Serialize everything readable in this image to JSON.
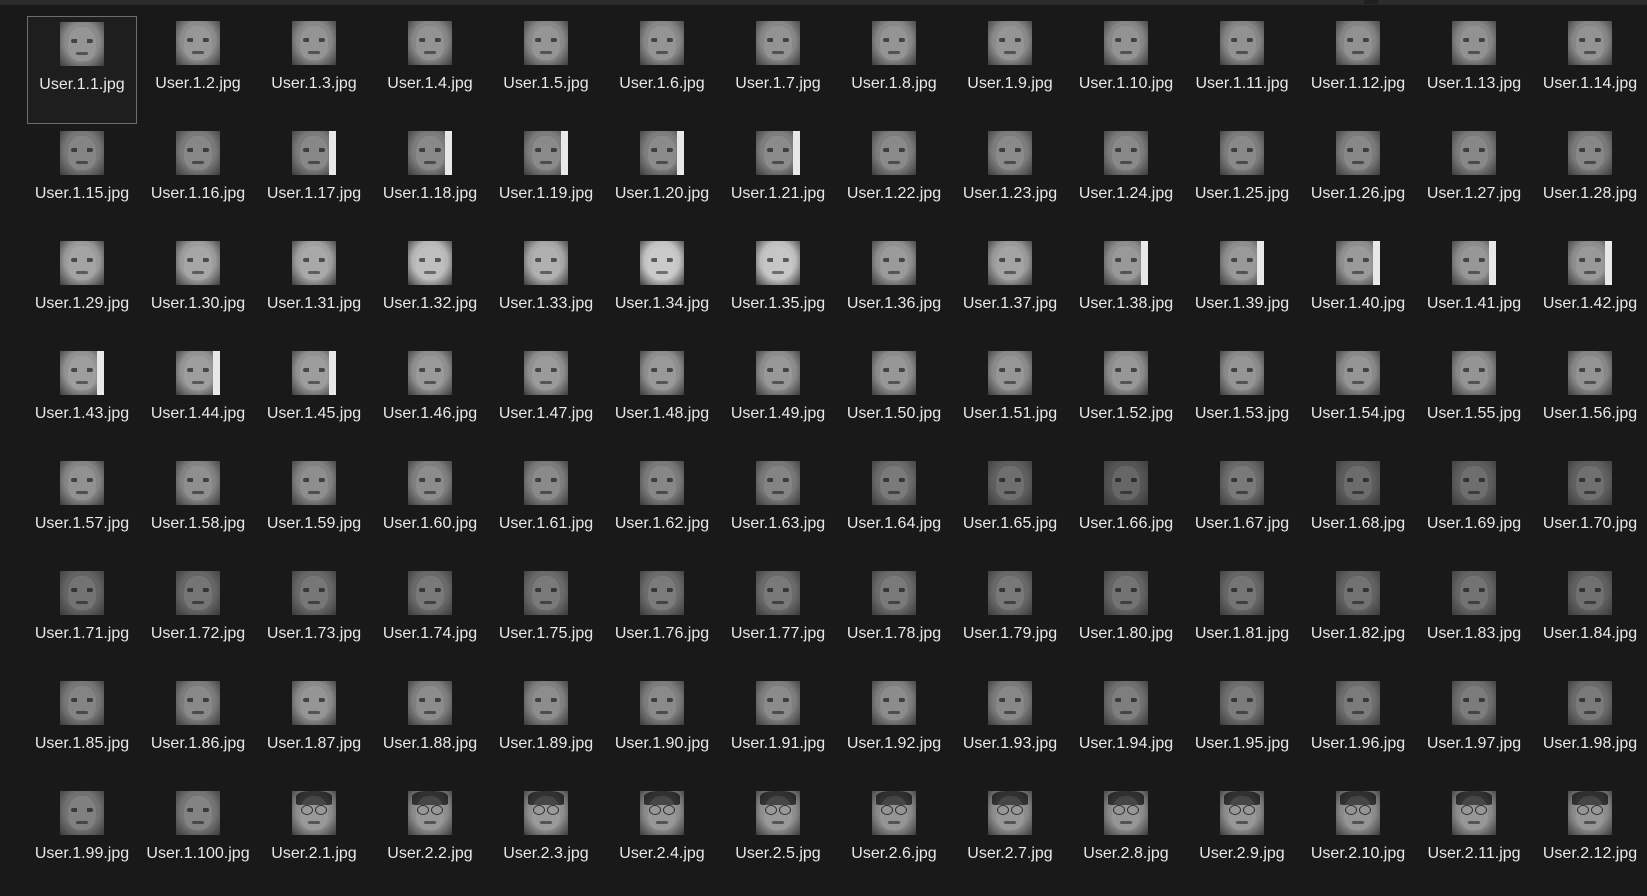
{
  "explorer": {
    "selected_index": 0,
    "files": [
      {
        "name": "User.1.1.jpg",
        "tone": "#8a8a8a"
      },
      {
        "name": "User.1.2.jpg",
        "tone": "#8c8c8c"
      },
      {
        "name": "User.1.3.jpg",
        "tone": "#888888"
      },
      {
        "name": "User.1.4.jpg",
        "tone": "#878787"
      },
      {
        "name": "User.1.5.jpg",
        "tone": "#898989"
      },
      {
        "name": "User.1.6.jpg",
        "tone": "#888888"
      },
      {
        "name": "User.1.7.jpg",
        "tone": "#878787"
      },
      {
        "name": "User.1.8.jpg",
        "tone": "#888888"
      },
      {
        "name": "User.1.9.jpg",
        "tone": "#8a8a8a"
      },
      {
        "name": "User.1.10.jpg",
        "tone": "#878787"
      },
      {
        "name": "User.1.11.jpg",
        "tone": "#868686"
      },
      {
        "name": "User.1.12.jpg",
        "tone": "#858585"
      },
      {
        "name": "User.1.13.jpg",
        "tone": "#868686"
      },
      {
        "name": "User.1.14.jpg",
        "tone": "#878787"
      },
      {
        "name": "User.1.15.jpg",
        "tone": "#787878"
      },
      {
        "name": "User.1.16.jpg",
        "tone": "#7a7a7a"
      },
      {
        "name": "User.1.17.jpg",
        "tone": "#7b7b7b",
        "stripe": true
      },
      {
        "name": "User.1.18.jpg",
        "tone": "#7c7c7c",
        "stripe": true
      },
      {
        "name": "User.1.19.jpg",
        "tone": "#7d7d7d",
        "stripe": true
      },
      {
        "name": "User.1.20.jpg",
        "tone": "#7e7e7e",
        "stripe": true
      },
      {
        "name": "User.1.21.jpg",
        "tone": "#7e7e7e",
        "stripe": true
      },
      {
        "name": "User.1.22.jpg",
        "tone": "#7d7d7d"
      },
      {
        "name": "User.1.23.jpg",
        "tone": "#7d7d7d"
      },
      {
        "name": "User.1.24.jpg",
        "tone": "#7c7c7c"
      },
      {
        "name": "User.1.25.jpg",
        "tone": "#7c7c7c"
      },
      {
        "name": "User.1.26.jpg",
        "tone": "#7b7b7b"
      },
      {
        "name": "User.1.27.jpg",
        "tone": "#7b7b7b"
      },
      {
        "name": "User.1.28.jpg",
        "tone": "#7a7a7a"
      },
      {
        "name": "User.1.29.jpg",
        "tone": "#9a9a9a"
      },
      {
        "name": "User.1.30.jpg",
        "tone": "#9c9c9c"
      },
      {
        "name": "User.1.31.jpg",
        "tone": "#a0a0a0"
      },
      {
        "name": "User.1.32.jpg",
        "tone": "#b8b8b8"
      },
      {
        "name": "User.1.33.jpg",
        "tone": "#a8a8a8"
      },
      {
        "name": "User.1.34.jpg",
        "tone": "#c4c4c4"
      },
      {
        "name": "User.1.35.jpg",
        "tone": "#c0c0c0"
      },
      {
        "name": "User.1.36.jpg",
        "tone": "#909090"
      },
      {
        "name": "User.1.37.jpg",
        "tone": "#9a9a9a"
      },
      {
        "name": "User.1.38.jpg",
        "tone": "#8e8e8e",
        "stripe": true
      },
      {
        "name": "User.1.39.jpg",
        "tone": "#8e8e8e",
        "stripe": true
      },
      {
        "name": "User.1.40.jpg",
        "tone": "#8f8f8f",
        "stripe": true
      },
      {
        "name": "User.1.41.jpg",
        "tone": "#8c8c8c",
        "stripe": true
      },
      {
        "name": "User.1.42.jpg",
        "tone": "#8e8e8e",
        "stripe": true
      },
      {
        "name": "User.1.43.jpg",
        "tone": "#939393",
        "stripe": true
      },
      {
        "name": "User.1.44.jpg",
        "tone": "#949494",
        "stripe": true
      },
      {
        "name": "User.1.45.jpg",
        "tone": "#929292",
        "stripe": true
      },
      {
        "name": "User.1.46.jpg",
        "tone": "#8f8f8f"
      },
      {
        "name": "User.1.47.jpg",
        "tone": "#909090"
      },
      {
        "name": "User.1.48.jpg",
        "tone": "#8e8e8e"
      },
      {
        "name": "User.1.49.jpg",
        "tone": "#8d8d8d"
      },
      {
        "name": "User.1.50.jpg",
        "tone": "#8c8c8c"
      },
      {
        "name": "User.1.51.jpg",
        "tone": "#8b8b8b"
      },
      {
        "name": "User.1.52.jpg",
        "tone": "#8c8c8c"
      },
      {
        "name": "User.1.53.jpg",
        "tone": "#8a8a8a"
      },
      {
        "name": "User.1.54.jpg",
        "tone": "#898989"
      },
      {
        "name": "User.1.55.jpg",
        "tone": "#888888"
      },
      {
        "name": "User.1.56.jpg",
        "tone": "#878787"
      },
      {
        "name": "User.1.57.jpg",
        "tone": "#858585"
      },
      {
        "name": "User.1.58.jpg",
        "tone": "#838383"
      },
      {
        "name": "User.1.59.jpg",
        "tone": "#828282"
      },
      {
        "name": "User.1.60.jpg",
        "tone": "#7f7f7f"
      },
      {
        "name": "User.1.61.jpg",
        "tone": "#7d7d7d"
      },
      {
        "name": "User.1.62.jpg",
        "tone": "#7a7a7a"
      },
      {
        "name": "User.1.63.jpg",
        "tone": "#777777"
      },
      {
        "name": "User.1.64.jpg",
        "tone": "#6b6b6b"
      },
      {
        "name": "User.1.65.jpg",
        "tone": "#5f5f5f"
      },
      {
        "name": "User.1.66.jpg",
        "tone": "#555555"
      },
      {
        "name": "User.1.67.jpg",
        "tone": "#6a6a6a"
      },
      {
        "name": "User.1.68.jpg",
        "tone": "#5c5c5c"
      },
      {
        "name": "User.1.69.jpg",
        "tone": "#5e5e5e"
      },
      {
        "name": "User.1.70.jpg",
        "tone": "#606060"
      },
      {
        "name": "User.1.71.jpg",
        "tone": "#646464"
      },
      {
        "name": "User.1.72.jpg",
        "tone": "#666666"
      },
      {
        "name": "User.1.73.jpg",
        "tone": "#686868"
      },
      {
        "name": "User.1.74.jpg",
        "tone": "#6a6a6a"
      },
      {
        "name": "User.1.75.jpg",
        "tone": "#6b6b6b"
      },
      {
        "name": "User.1.76.jpg",
        "tone": "#6c6c6c"
      },
      {
        "name": "User.1.77.jpg",
        "tone": "#6a6a6a"
      },
      {
        "name": "User.1.78.jpg",
        "tone": "#6b6b6b"
      },
      {
        "name": "User.1.79.jpg",
        "tone": "#696969"
      },
      {
        "name": "User.1.80.jpg",
        "tone": "#646464"
      },
      {
        "name": "User.1.81.jpg",
        "tone": "#666666"
      },
      {
        "name": "User.1.82.jpg",
        "tone": "#626262"
      },
      {
        "name": "User.1.83.jpg",
        "tone": "#646464"
      },
      {
        "name": "User.1.84.jpg",
        "tone": "#606060"
      },
      {
        "name": "User.1.85.jpg",
        "tone": "#777777"
      },
      {
        "name": "User.1.86.jpg",
        "tone": "#7c7c7c"
      },
      {
        "name": "User.1.87.jpg",
        "tone": "#8a8a8a"
      },
      {
        "name": "User.1.88.jpg",
        "tone": "#7f7f7f"
      },
      {
        "name": "User.1.89.jpg",
        "tone": "#818181"
      },
      {
        "name": "User.1.90.jpg",
        "tone": "#7d7d7d"
      },
      {
        "name": "User.1.91.jpg",
        "tone": "#7e7e7e"
      },
      {
        "name": "User.1.92.jpg",
        "tone": "#7f7f7f"
      },
      {
        "name": "User.1.93.jpg",
        "tone": "#7b7b7b"
      },
      {
        "name": "User.1.94.jpg",
        "tone": "#707070"
      },
      {
        "name": "User.1.95.jpg",
        "tone": "#6e6e6e"
      },
      {
        "name": "User.1.96.jpg",
        "tone": "#6d6d6d"
      },
      {
        "name": "User.1.97.jpg",
        "tone": "#6e6e6e"
      },
      {
        "name": "User.1.98.jpg",
        "tone": "#6b6b6b"
      },
      {
        "name": "User.1.99.jpg",
        "tone": "#727272"
      },
      {
        "name": "User.1.100.jpg",
        "tone": "#757575"
      },
      {
        "name": "User.2.1.jpg",
        "tone": "#8e8e8e",
        "glasses": true
      },
      {
        "name": "User.2.2.jpg",
        "tone": "#8c8c8c",
        "glasses": true
      },
      {
        "name": "User.2.3.jpg",
        "tone": "#8f8f8f",
        "glasses": true
      },
      {
        "name": "User.2.4.jpg",
        "tone": "#8d8d8d",
        "glasses": true
      },
      {
        "name": "User.2.5.jpg",
        "tone": "#8e8e8e",
        "glasses": true
      },
      {
        "name": "User.2.6.jpg",
        "tone": "#8a8a8a",
        "glasses": true
      },
      {
        "name": "User.2.7.jpg",
        "tone": "#8c8c8c",
        "glasses": true
      },
      {
        "name": "User.2.8.jpg",
        "tone": "#8b8b8b",
        "glasses": true
      },
      {
        "name": "User.2.9.jpg",
        "tone": "#8d8d8d",
        "glasses": true
      },
      {
        "name": "User.2.10.jpg",
        "tone": "#8a8a8a",
        "glasses": true
      },
      {
        "name": "User.2.11.jpg",
        "tone": "#8c8c8c",
        "glasses": true
      },
      {
        "name": "User.2.12.jpg",
        "tone": "#8b8b8b",
        "glasses": true
      }
    ]
  }
}
